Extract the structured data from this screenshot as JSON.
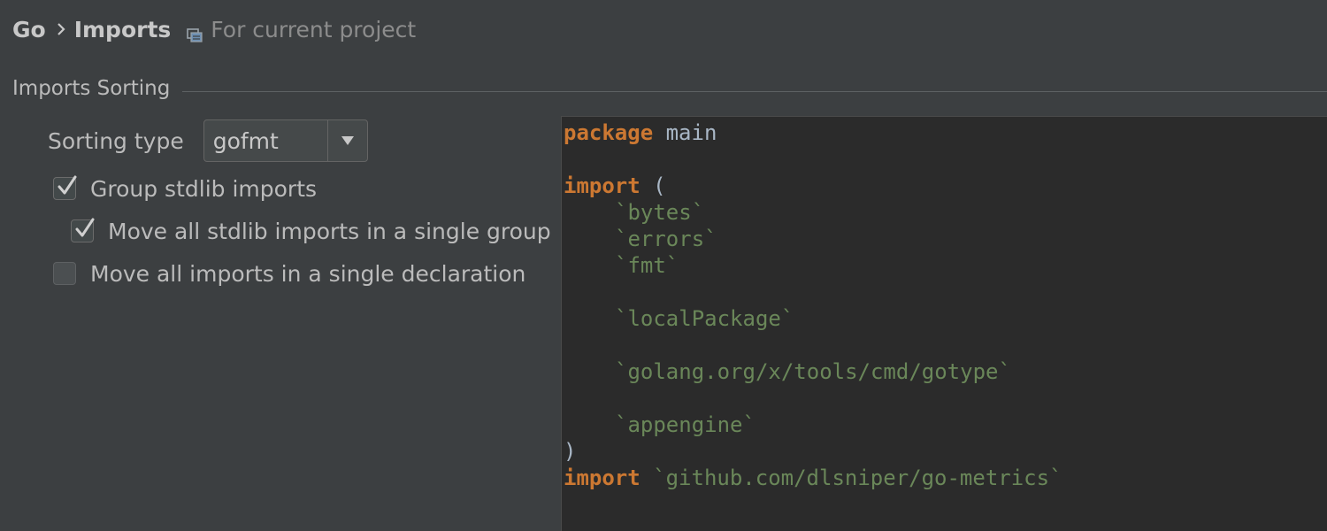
{
  "breadcrumb": {
    "root": "Go",
    "separator_icon": "chevron-right-icon",
    "current": "Imports",
    "scope_icon": "project-scope-icon",
    "scope_label": "For current project"
  },
  "section": {
    "title": "Imports Sorting"
  },
  "sorting": {
    "label": "Sorting type",
    "selected": "gofmt",
    "dropdown_icon": "triangle-down-icon"
  },
  "options": [
    {
      "label": "Group stdlib imports",
      "checked": true
    },
    {
      "label": "Move all stdlib imports in a single group",
      "checked": true
    },
    {
      "label": "Move all imports in a single declaration",
      "checked": false
    }
  ],
  "preview": {
    "line1_kw": "package",
    "line1_id": " main",
    "line2_kw": "import",
    "line2_rest": " (",
    "imports": [
      "`bytes`",
      "`errors`",
      "`fmt`",
      "`localPackage`",
      "`golang.org/x/tools/cmd/gotype`",
      "`appengine`"
    ],
    "close_paren": ")",
    "last_kw": "import",
    "last_str": " `github.com/dlsniper/go-metrics`"
  },
  "colors": {
    "background": "#3c3f41",
    "editor_background": "#2b2b2b",
    "keyword": "#cc7832",
    "string": "#6a8759",
    "identifier": "#a9b7c6"
  }
}
